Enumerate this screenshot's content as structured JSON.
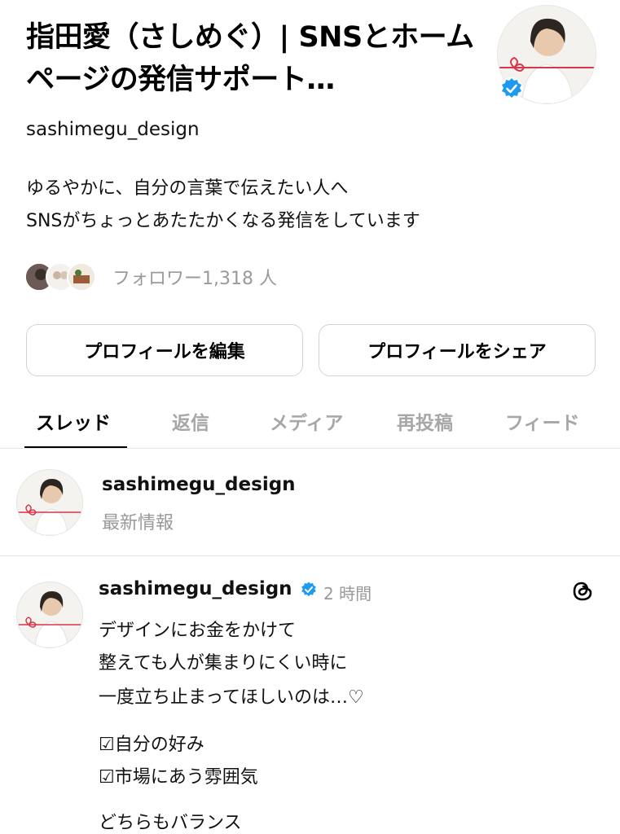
{
  "profile": {
    "display_name": "指田愛（さしめぐ）| SNSとホームページの発信サポート…",
    "handle": "sashimegu_design",
    "bio_line1": "ゆるやかに、自分の言葉で伝えたい人へ",
    "bio_line2": "SNSがちょっとあたたかくなる発信をしています",
    "followers_label": "フォロワー1,318 人",
    "verified": true
  },
  "buttons": {
    "edit_profile": "プロフィールを編集",
    "share_profile": "プロフィールをシェア"
  },
  "tabs": [
    "スレッド",
    "返信",
    "メディア",
    "再投稿",
    "フィード"
  ],
  "latest": {
    "username": "sashimegu_design",
    "subtitle": "最新情報"
  },
  "post": {
    "username": "sashimegu_design",
    "time": "2 時間",
    "lines": [
      "デザインにお金をかけて",
      "整えても人が集まりにくい時に",
      "一度立ち止まってほしいのは…♡",
      "☑自分の好み",
      "☑市場にあう雰囲気",
      "どちらもバランス"
    ]
  },
  "colors": {
    "verified_blue": "#1d9bf0",
    "muted_text": "#999999",
    "accent_red": "#d9364a"
  }
}
